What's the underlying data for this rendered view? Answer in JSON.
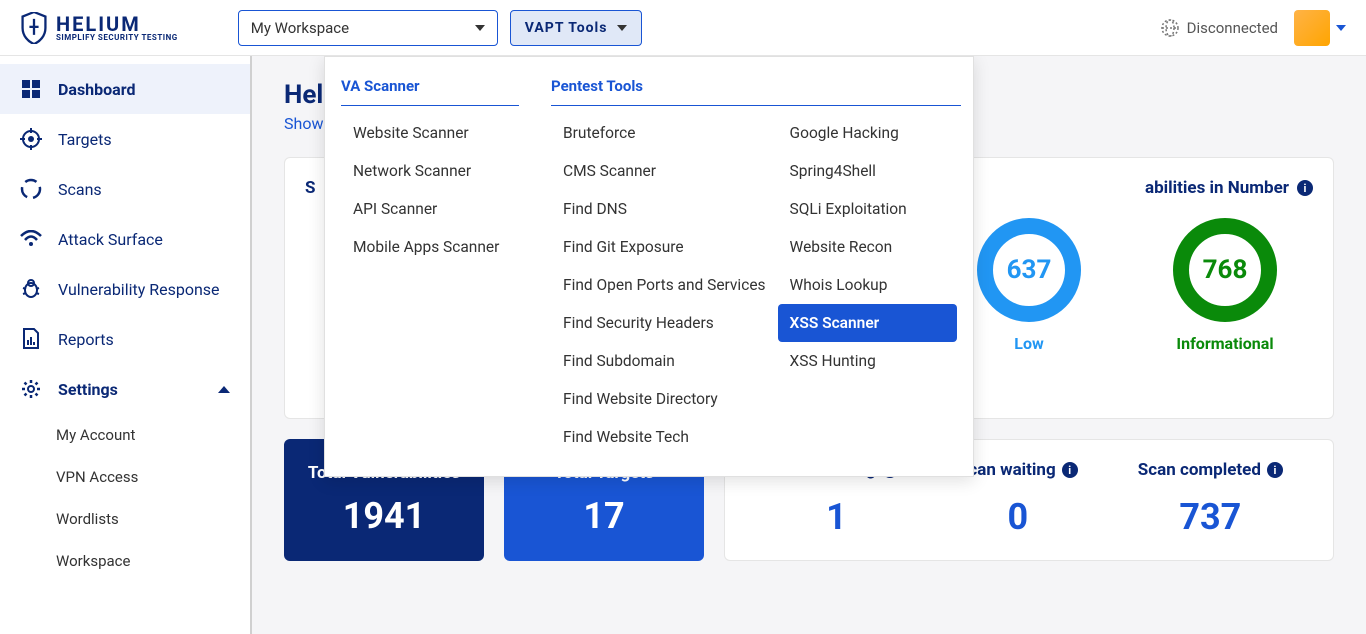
{
  "brand": {
    "name": "HELIUM",
    "tagline": "SIMPLIFY SECURITY TESTING"
  },
  "topbar": {
    "workspace": "My Workspace",
    "vapt_label": "VAPT Tools",
    "connection": "Disconnected"
  },
  "sidebar": {
    "items": [
      {
        "label": "Dashboard"
      },
      {
        "label": "Targets"
      },
      {
        "label": "Scans"
      },
      {
        "label": "Attack Surface"
      },
      {
        "label": "Vulnerability Response"
      },
      {
        "label": "Reports"
      },
      {
        "label": "Settings"
      }
    ],
    "settings_children": [
      {
        "label": "My Account"
      },
      {
        "label": "VPN Access"
      },
      {
        "label": "Wordlists"
      },
      {
        "label": "Workspace"
      }
    ]
  },
  "page": {
    "title": "Helium",
    "subtitle": "Showing v"
  },
  "vuln_card": {
    "title_left": "S",
    "title_right": "abilities in Number",
    "donuts": [
      {
        "value": "637",
        "label": "Low",
        "color": "blue"
      },
      {
        "value": "768",
        "label": "Informational",
        "color": "green"
      }
    ]
  },
  "stats": {
    "total_vuln": {
      "title": "Total Vulnerabilities",
      "value": "1941"
    },
    "total_targets": {
      "title": "Total Targets",
      "value": "17"
    },
    "scan_running": {
      "title": "Scan running",
      "value": "1"
    },
    "scan_waiting": {
      "title": "Scan waiting",
      "value": "0"
    },
    "scan_completed": {
      "title": "Scan completed",
      "value": "737"
    }
  },
  "dropdown": {
    "col1_head": "VA Scanner",
    "col1": [
      "Website Scanner",
      "Network Scanner",
      "API Scanner",
      "Mobile Apps Scanner"
    ],
    "col2_head": "Pentest Tools",
    "col2": [
      "Bruteforce",
      "CMS Scanner",
      "Find DNS",
      "Find Git Exposure",
      "Find Open Ports and Services",
      "Find Security Headers",
      "Find Subdomain",
      "Find Website Directory",
      "Find Website Tech"
    ],
    "col3": [
      "Google Hacking",
      "Spring4Shell",
      "SQLi Exploitation",
      "Website Recon",
      "Whois Lookup",
      "XSS Scanner",
      "XSS Hunting"
    ],
    "active": "XSS Scanner"
  }
}
